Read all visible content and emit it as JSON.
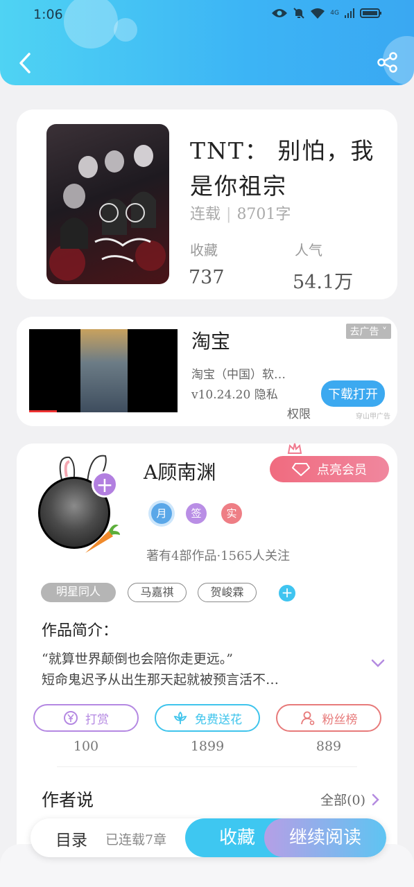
{
  "status_bar": {
    "time": "1:06",
    "network": "4G"
  },
  "book": {
    "title": "TNT： 别怕，我是你祖宗",
    "status": "连载",
    "word_count": "8701字",
    "collect_label": "收藏",
    "collect_value": "737",
    "popularity_label": "人气",
    "popularity_value": "54.1万"
  },
  "ad": {
    "title": "淘宝",
    "close_label": "去广告",
    "description": "淘宝（中国）软…",
    "version": "v10.24.20 隐私",
    "permission": "权限",
    "download_label": "下载打开",
    "source": "穿山甲广告"
  },
  "author": {
    "name": "A顾南渊",
    "vip_label": "点亮会员",
    "badges": [
      "月",
      "签",
      "实"
    ],
    "meta": "著有4部作品·1565人关注",
    "tags": [
      "明星同人",
      "马嘉祺",
      "贺峻霖"
    ],
    "intro_label": "作品简介：",
    "intro_line1": "“就算世界颠倒也会陪你走更远。”",
    "intro_line2": "短命鬼迟予从出生那天起就被预言活不…",
    "actions": [
      {
        "label": "打赏",
        "count": "100",
        "color": "#b488e2"
      },
      {
        "label": "免费送花",
        "count": "1899",
        "color": "#3fc4ec"
      },
      {
        "label": "粉丝榜",
        "count": "889",
        "color": "#e77a7a"
      }
    ],
    "author_say_label": "作者说",
    "all_label": "全部(0)"
  },
  "bottom_bar": {
    "catalog_label": "目录",
    "chapters_label": "已连载7章",
    "collect_label": "收藏",
    "read_label": "继续阅读"
  }
}
